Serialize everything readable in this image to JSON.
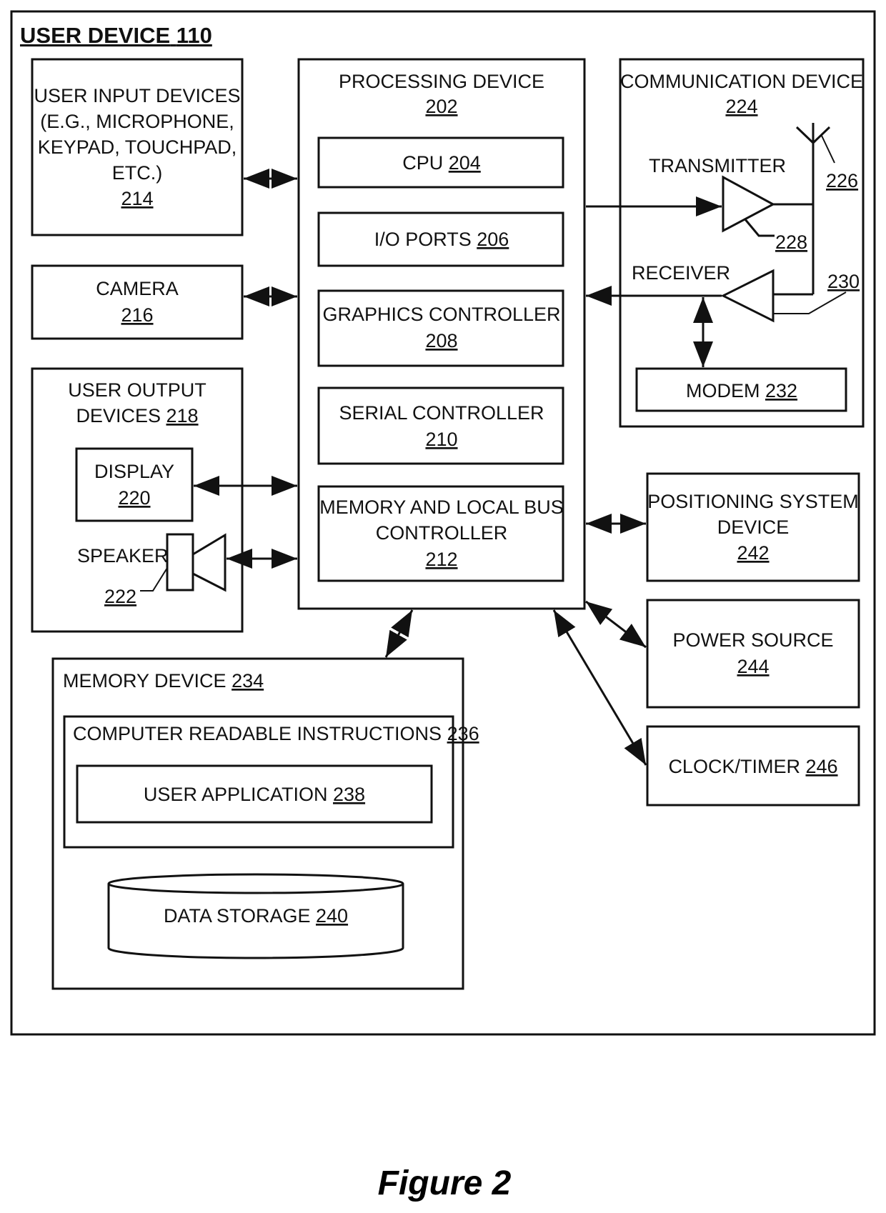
{
  "figure": {
    "title": "USER DEVICE",
    "title_ref": "110",
    "caption": "Figure 2"
  },
  "blocks": {
    "user_input": {
      "lines": [
        "USER INPUT DEVICES",
        "(E.G., MICROPHONE,",
        "KEYPAD, TOUCHPAD,",
        "ETC.)"
      ],
      "ref": "214"
    },
    "camera": {
      "lines": [
        "CAMERA"
      ],
      "ref": "216"
    },
    "user_output": {
      "lines": [
        "USER OUTPUT",
        "DEVICES"
      ],
      "ref": "218"
    },
    "display": {
      "lines": [
        "DISPLAY"
      ],
      "ref": "220"
    },
    "speaker": {
      "label": "SPEAKER",
      "ref": "222"
    },
    "processing": {
      "lines": [
        "PROCESSING DEVICE"
      ],
      "ref": "202"
    },
    "cpu": {
      "label": "CPU",
      "ref": "204"
    },
    "io_ports": {
      "label": "I/O PORTS",
      "ref": "206"
    },
    "graphics": {
      "lines": [
        "GRAPHICS CONTROLLER"
      ],
      "ref": "208"
    },
    "serial": {
      "lines": [
        "SERIAL CONTROLLER"
      ],
      "ref": "210"
    },
    "memory_bus": {
      "lines": [
        "MEMORY AND LOCAL BUS",
        "CONTROLLER"
      ],
      "ref": "212"
    },
    "communication": {
      "lines": [
        "COMMUNICATION DEVICE"
      ],
      "ref": "224"
    },
    "antenna": {
      "ref": "226"
    },
    "transmitter": {
      "label": "TRANSMITTER",
      "ref": "228"
    },
    "receiver": {
      "label": "RECEIVER",
      "ref": "230"
    },
    "modem": {
      "label": "MODEM",
      "ref": "232"
    },
    "memory_device": {
      "label": "MEMORY DEVICE",
      "ref": "234"
    },
    "instructions": {
      "label": "COMPUTER READABLE INSTRUCTIONS",
      "ref": "236"
    },
    "user_app": {
      "label": "USER APPLICATION",
      "ref": "238"
    },
    "data_storage": {
      "label": "DATA STORAGE",
      "ref": "240"
    },
    "positioning": {
      "lines": [
        "POSITIONING SYSTEM",
        "DEVICE"
      ],
      "ref": "242"
    },
    "power": {
      "lines": [
        "POWER SOURCE"
      ],
      "ref": "244"
    },
    "clock": {
      "label": "CLOCK/TIMER",
      "ref": "246"
    }
  },
  "connections": [
    {
      "from": "user_input",
      "to": "processing",
      "direction": "bidirectional"
    },
    {
      "from": "camera",
      "to": "processing",
      "direction": "bidirectional"
    },
    {
      "from": "display",
      "to": "processing",
      "direction": "bidirectional"
    },
    {
      "from": "speaker",
      "to": "processing",
      "direction": "bidirectional"
    },
    {
      "from": "processing",
      "to": "transmitter",
      "direction": "forward"
    },
    {
      "from": "receiver",
      "to": "processing",
      "direction": "forward"
    },
    {
      "from": "receiver",
      "to": "modem",
      "direction": "bidirectional"
    },
    {
      "from": "processing",
      "to": "positioning",
      "direction": "bidirectional"
    },
    {
      "from": "processing",
      "to": "power",
      "direction": "bidirectional"
    },
    {
      "from": "processing",
      "to": "clock",
      "direction": "bidirectional"
    },
    {
      "from": "processing",
      "to": "memory_device",
      "direction": "bidirectional"
    }
  ]
}
